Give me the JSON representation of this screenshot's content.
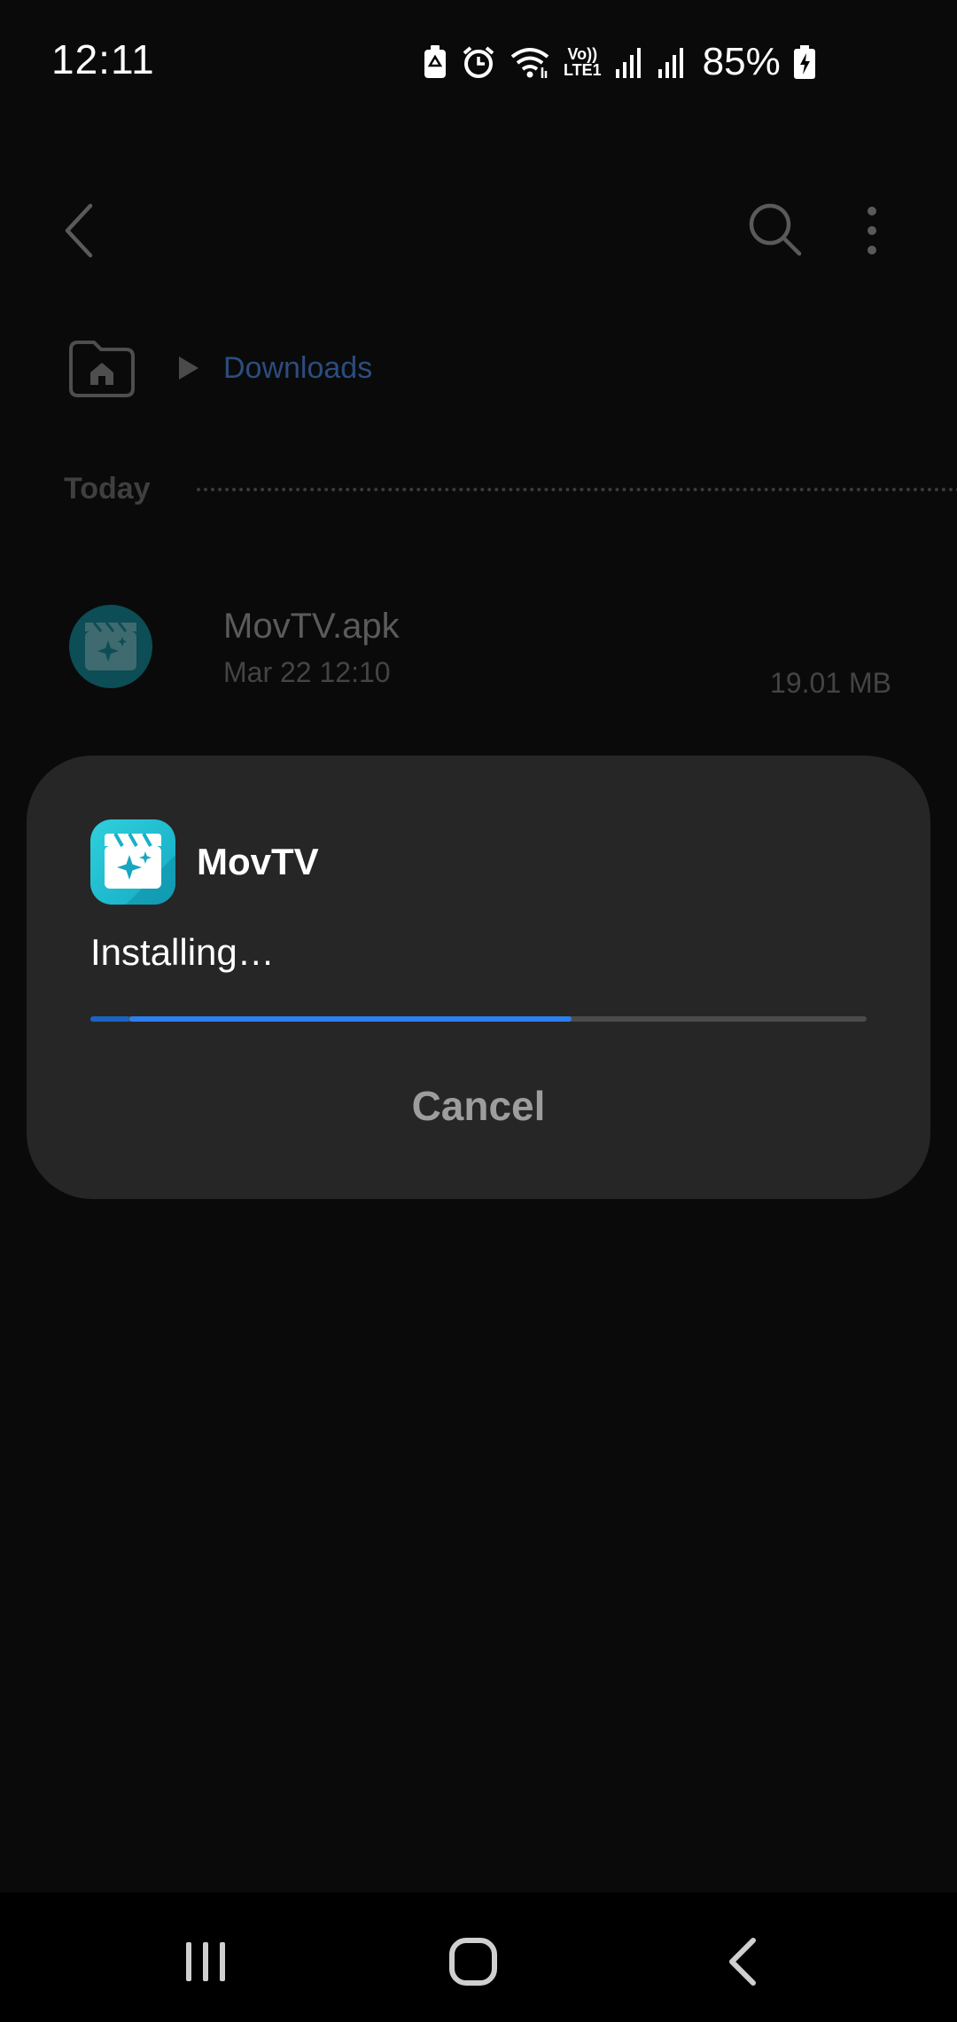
{
  "status_bar": {
    "time": "12:11",
    "volte_top": "Vo))",
    "volte_bottom": "LTE1",
    "battery_percent": "85%",
    "icons": [
      "battery-saver-icon",
      "alarm-icon",
      "wifi-icon",
      "volte-icon",
      "signal-icon",
      "signal-icon",
      "battery-charging-icon"
    ]
  },
  "app_bar": {
    "icons": [
      "back-arrow-icon",
      "search-icon",
      "more-options-icon"
    ]
  },
  "breadcrumb": {
    "home_icon": "home-folder-icon",
    "separator_icon": "play-arrow-icon",
    "current": "Downloads"
  },
  "section": {
    "label": "Today"
  },
  "file": {
    "name": "MovTV.apk",
    "date": "Mar 22 12:10",
    "size": "19.01 MB",
    "icon": "movie-clapper-icon"
  },
  "dialog": {
    "app_name": "MovTV",
    "status": "Installing…",
    "progress": 0.62,
    "secondary_progress": 0.05,
    "cancel_label": "Cancel",
    "icon": "movie-clapper-sparkle-icon"
  },
  "nav_bar": {
    "icons": [
      "recents-icon",
      "home-icon",
      "back-icon"
    ]
  },
  "colors": {
    "background": "#0a0a0a",
    "dialog": "#262626",
    "accent": "#2d7ff0",
    "breadcrumb_link": "#2b4d7e",
    "app_icon": "#14a9c3"
  }
}
